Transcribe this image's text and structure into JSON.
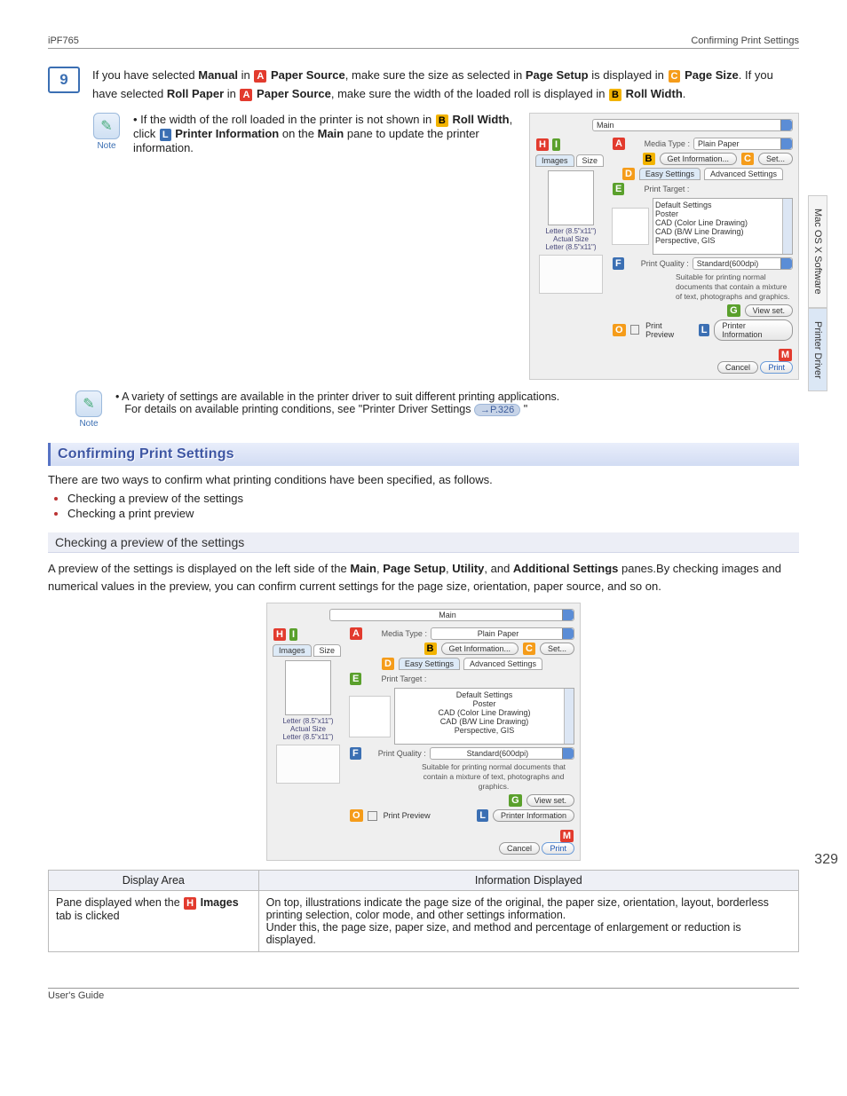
{
  "header": {
    "left": "iPF765",
    "right": "Confirming Print Settings"
  },
  "sidetabs": {
    "a": "Mac OS X Software",
    "b": "Printer Driver"
  },
  "step9": {
    "number": "9",
    "parts": {
      "p1a": "If you have selected ",
      "p1b": "Manual",
      "p1c": " in ",
      "p1d": "A",
      "p1e": " Paper Source",
      "p1f": ", make sure the size as selected in ",
      "p1g": "Page Setup",
      "p1h": " is displayed in ",
      "p2a": "C",
      "p2b": " Page Size",
      "p2c": ". If you have selected ",
      "p2d": "Roll Paper",
      "p2e": " in ",
      "p2f": "A",
      "p2g": " Paper Source",
      "p2h": ", make sure the width of the loaded roll is displayed in ",
      "p2i": "B",
      "p2j": " Roll Width",
      "p2k": "."
    }
  },
  "note1": {
    "label": "Note",
    "bullet_prefix": "• ",
    "l1": "If the width of the roll loaded in the printer is not shown in ",
    "l2": "B",
    "l3": " Roll Width",
    "l4": ", click ",
    "l5": "L",
    "l6": " Printer Information",
    "l7": " on the ",
    "l8": "Main",
    "l9": " pane to update the printer information."
  },
  "screenshot": {
    "main_tab": "Main",
    "tab_images": "Images",
    "tab_size": "Size",
    "media_type_label": "Media Type :",
    "media_type_value": "Plain Paper",
    "get_info": "Get Information...",
    "set": "Set...",
    "easy": "Easy Settings",
    "adv": "Advanced Settings",
    "pt_label": "Print Target :",
    "pt_opts": [
      "Default Settings",
      "Poster",
      "CAD (Color Line Drawing)",
      "CAD (B/W Line Drawing)",
      "Perspective, GIS"
    ],
    "pq_label": "Print Quality :",
    "pq_value": "Standard(600dpi)",
    "pq_desc": "Suitable for printing normal documents that contain a mixture of text, photographs and graphics.",
    "view_set": "View set.",
    "preview": "Print Preview",
    "pinfo": "Printer Information",
    "cancel": "Cancel",
    "print": "Print",
    "pv1": "Letter (8.5\"x11\")",
    "pv2": "Actual Size",
    "pv3": "Letter (8.5\"x11\")"
  },
  "note2": {
    "label": "Note",
    "b1": "A variety of settings are available in the printer driver to suit different printing applications.",
    "b2a": "For details on available printing conditions, see \"Printer Driver Settings ",
    "b2b": "→P.326",
    "b2c": " \""
  },
  "section": {
    "title": "Confirming Print Settings",
    "intro": "There are two ways to confirm what printing conditions have been specified, as follows.",
    "bullets": [
      "Checking a preview of the settings",
      "Checking a print preview"
    ],
    "sub_title": "Checking a preview of the settings",
    "sub_body_a": "A preview of the settings is displayed on the left side of the ",
    "sub_b1": "Main",
    "sub_c": ", ",
    "sub_b2": "Page Setup",
    "sub_d": ", ",
    "sub_b3": "Utility",
    "sub_e": ", and ",
    "sub_b4": "Additional Settings",
    "sub_body_f": " panes.By checking images and numerical values in the preview, you can confirm current settings for the page size, orientation, paper source, and so on."
  },
  "table": {
    "h1": "Display Area",
    "h2": "Information Displayed",
    "r1c1_a": "Pane displayed when the ",
    "r1c1_b": "H",
    "r1c1_c": " Images",
    "r1c1_d": " tab is clicked",
    "r1c2": "On top, illustrations indicate the page size of the original, the paper size, orientation, layout, borderless printing selection, color mode, and other settings information.\nUnder this, the page size, paper size, and method and percentage of enlargement or reduction is displayed."
  },
  "page_number": "329",
  "footer": {
    "left": "User's Guide",
    "right": ""
  }
}
